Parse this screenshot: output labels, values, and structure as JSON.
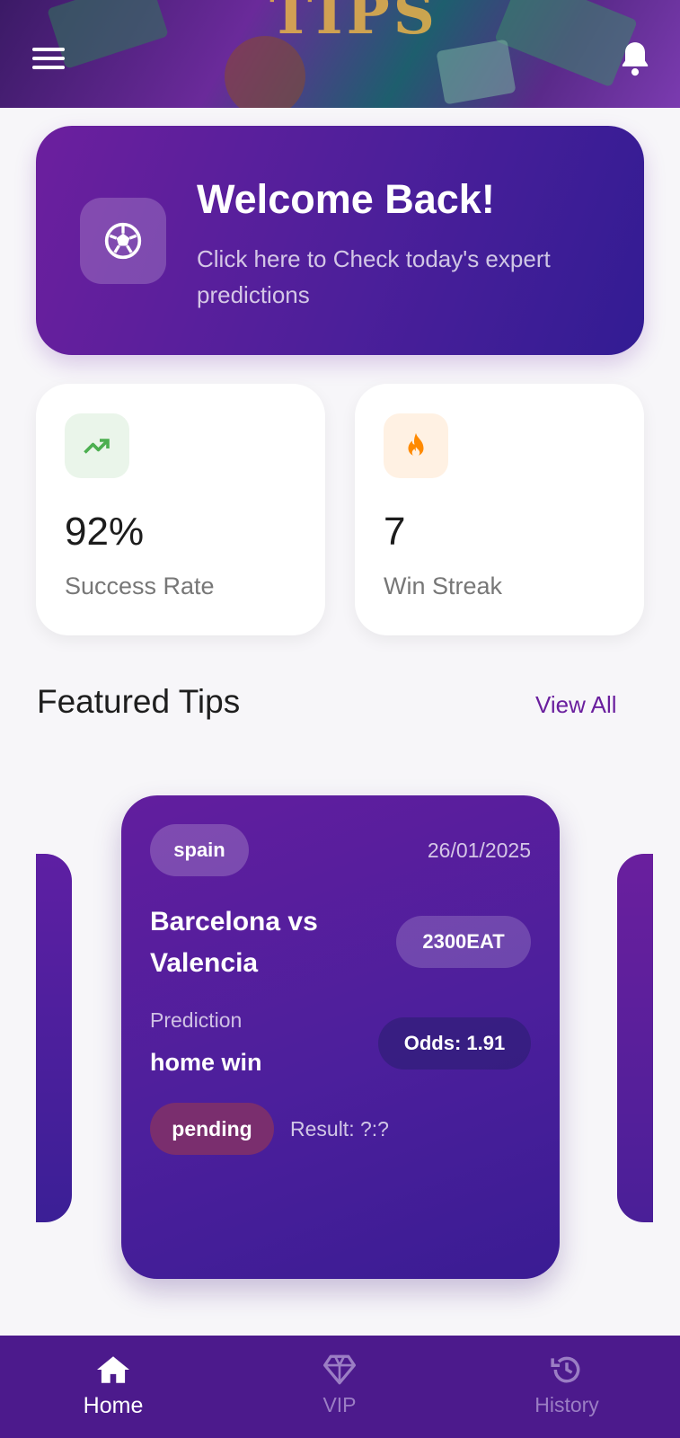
{
  "header": {
    "banner_text": "TIPS",
    "menu_icon": "hamburger-menu-icon",
    "notification_icon": "bell-icon"
  },
  "welcome": {
    "title": "Welcome Back!",
    "subtitle": "Click here to Check today's expert predictions",
    "icon": "soccer-ball-icon"
  },
  "stats": [
    {
      "value": "92%",
      "label": "Success Rate",
      "icon": "trending-up-icon",
      "icon_color": "#4caf50",
      "icon_bg": "#eaf5ea"
    },
    {
      "value": "7",
      "label": "Win Streak",
      "icon": "fire-icon",
      "icon_color": "#ff8a00",
      "icon_bg": "#fff1e3"
    }
  ],
  "featured": {
    "title": "Featured Tips",
    "view_all": "View All"
  },
  "tip": {
    "country": "spain",
    "date": "26/01/2025",
    "match": "Barcelona vs Valencia",
    "time": "2300EAT",
    "prediction_label": "Prediction",
    "prediction": "home win",
    "odds": "Odds: 1.91",
    "status": "pending",
    "result": "Result: ?:?"
  },
  "nav": [
    {
      "label": "Home",
      "icon": "home-icon",
      "active": true
    },
    {
      "label": "VIP",
      "icon": "diamond-icon",
      "active": false
    },
    {
      "label": "History",
      "icon": "history-icon",
      "active": false
    }
  ],
  "colors": {
    "accent": "#6a1f9e",
    "nav_bg": "#4c1a8c",
    "page_bg": "#f7f6f9"
  }
}
